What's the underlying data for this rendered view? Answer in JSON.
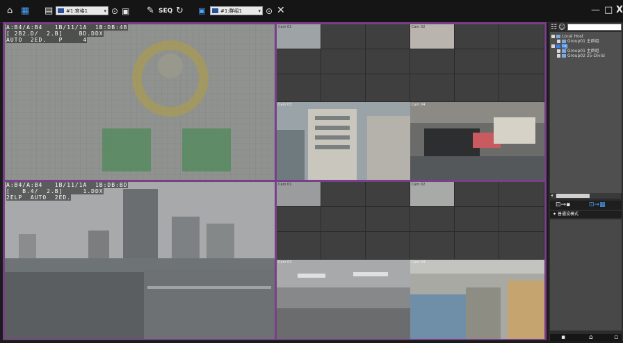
{
  "toolbar": {
    "layout_select": "#1:宫格1",
    "seq_label": "SEQ",
    "group_select": "#1:群组1"
  },
  "window_controls": {
    "minimize": "—",
    "maximize": "□",
    "close": "X"
  },
  "panes": {
    "top_left": {
      "osd_line1": "A:B4/A:B4   1B/11/1A  1B:DB:4B",
      "osd_line2": "[ 2B2.D/  2.B]    BD.DDX",
      "osd_line3": "AUTO  2ED.   P     4"
    },
    "bottom_left": {
      "osd_line1": "A:B4/A:B4   1B/11/1A  1B:DB:BD",
      "osd_line2": "[   B.4/  2.B]     1.DDX",
      "osd_line3": "2ELP  AUTO  2ED."
    },
    "top_right_tiles": [
      "Cam 01",
      "Cam 02",
      "Cam 03",
      "Cam 04"
    ],
    "bottom_right_tiles": [
      "Cam 01",
      "Cam 02",
      "Cam 03",
      "Cam 04"
    ]
  },
  "tree": {
    "items": [
      {
        "label": "Local Host"
      },
      {
        "label": "Group01  主群组"
      },
      {
        "label": "Gg"
      },
      {
        "label": "Group01  主群组"
      },
      {
        "label": "Group02  25-Divisi"
      }
    ]
  },
  "mode_label": "普通设模式",
  "colors": {
    "grid_border": "#7a3f8a",
    "toolbar_bg": "#151515",
    "accent": "#2a6fd6"
  }
}
